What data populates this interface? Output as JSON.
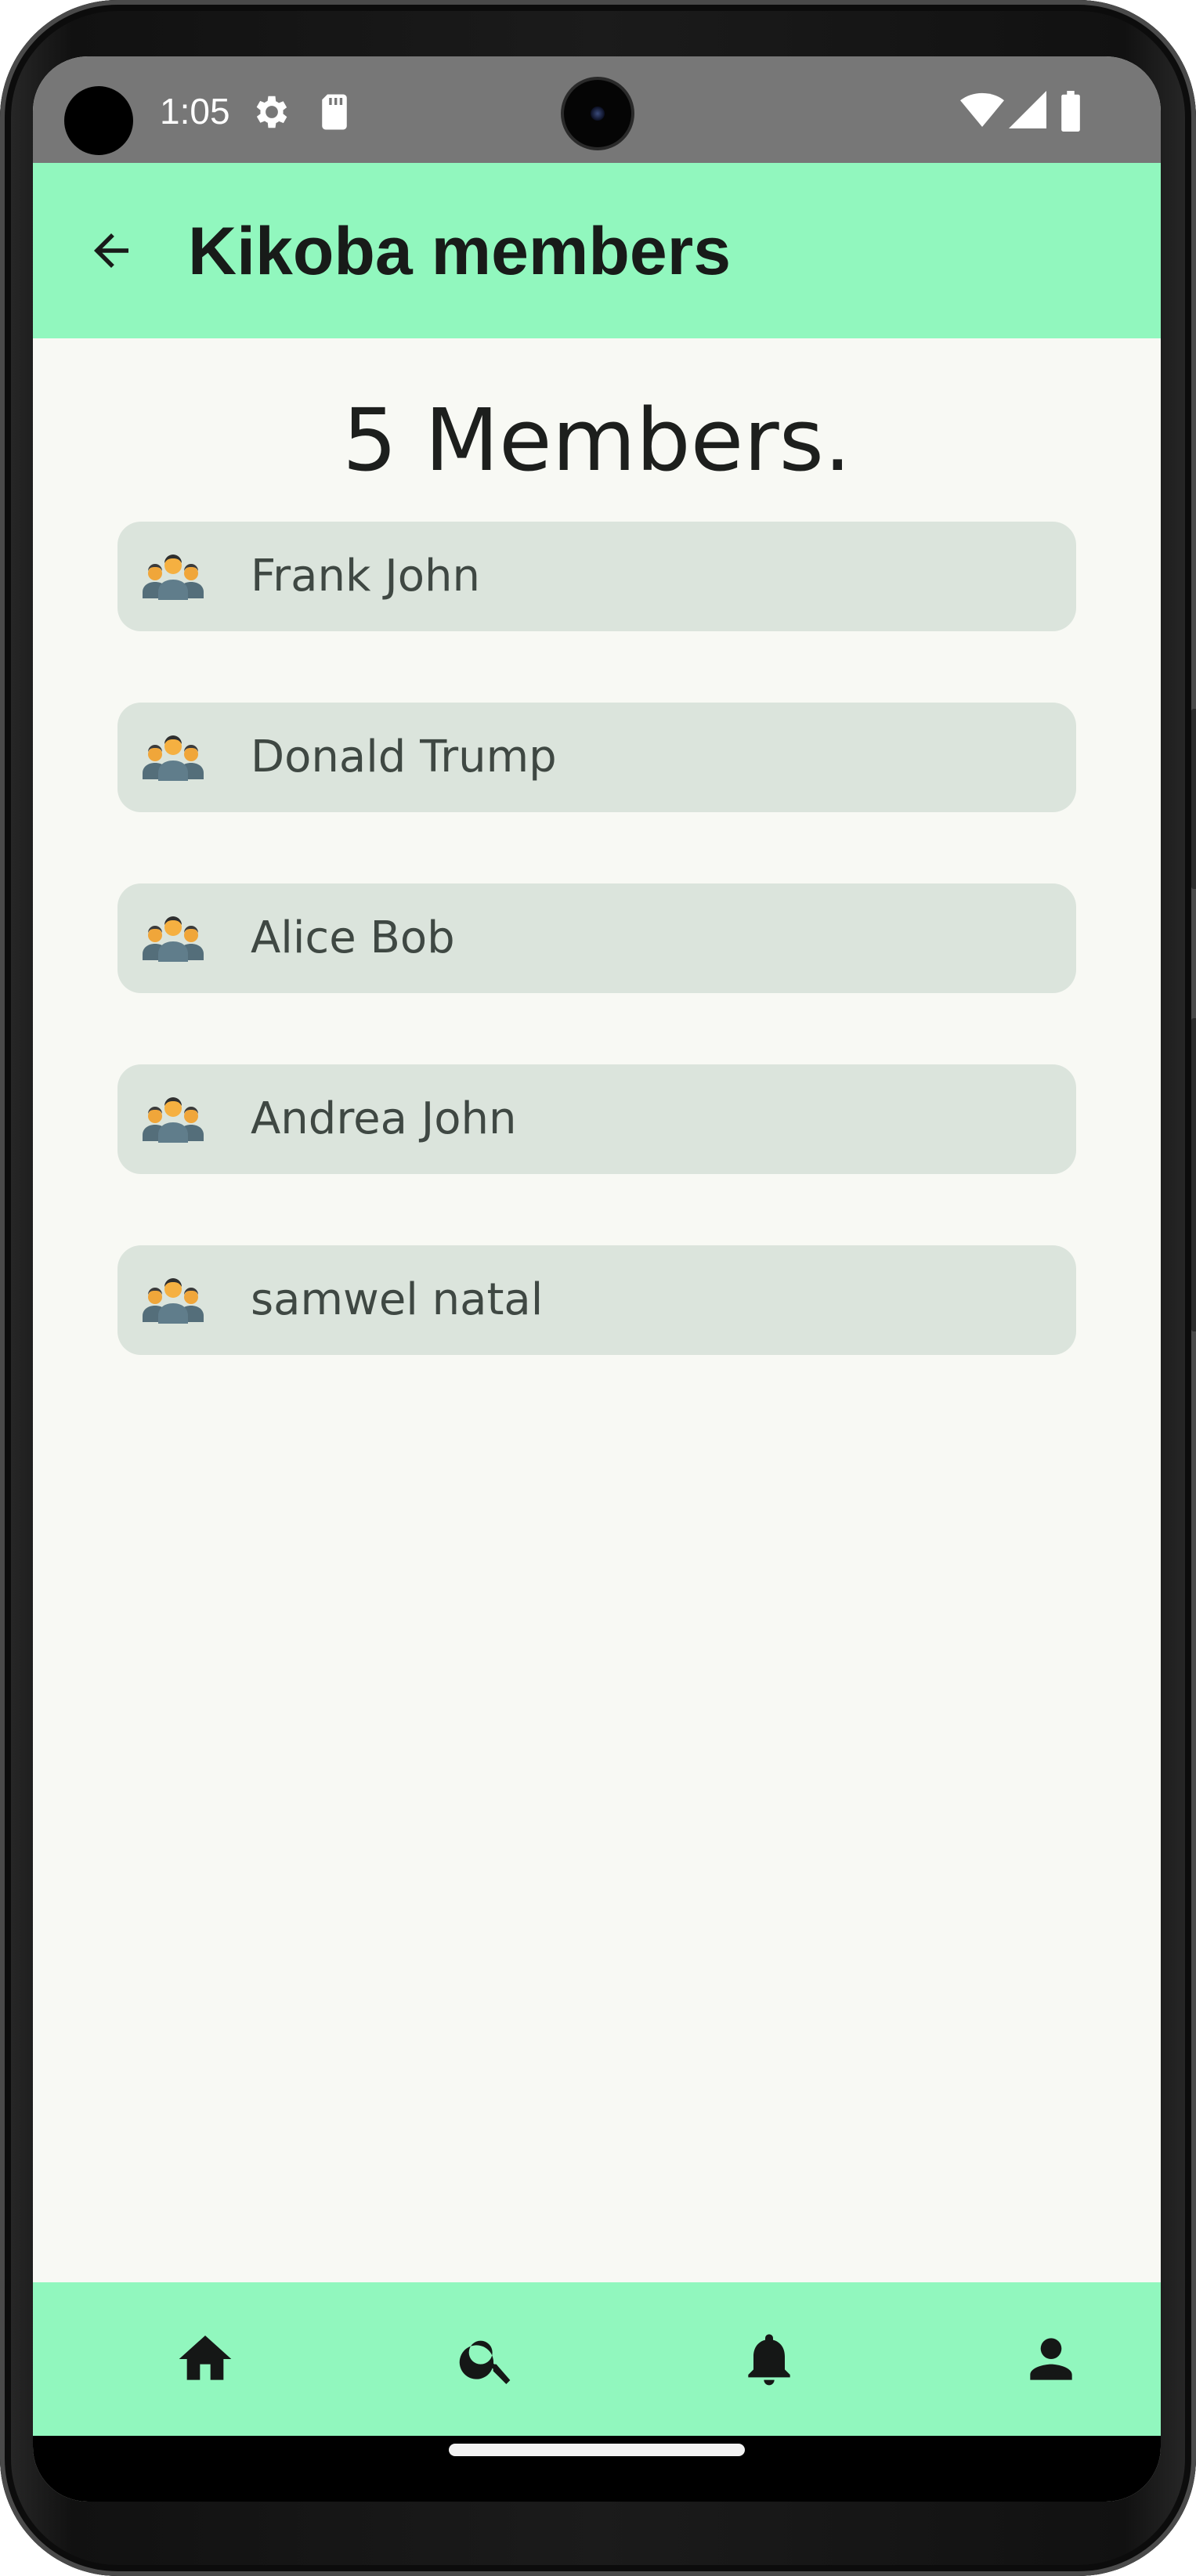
{
  "status_bar": {
    "time": "1:05",
    "icons": [
      "settings-gear-icon",
      "sd-card-icon",
      "wifi-icon",
      "cell-signal-icon",
      "battery-icon"
    ]
  },
  "app_bar": {
    "title": "Kikoba members",
    "back_icon": "arrow-left-icon"
  },
  "content": {
    "count_heading": "5 Members.",
    "members": [
      {
        "name": "Frank John",
        "icon": "group-people-icon"
      },
      {
        "name": "Donald Trump",
        "icon": "group-people-icon"
      },
      {
        "name": "Alice Bob",
        "icon": "group-people-icon"
      },
      {
        "name": "Andrea John",
        "icon": "group-people-icon"
      },
      {
        "name": "samwel natal",
        "icon": "group-people-icon"
      }
    ]
  },
  "bottom_nav": {
    "items": [
      {
        "icon": "home-icon"
      },
      {
        "icon": "search-icon"
      },
      {
        "icon": "bell-icon"
      },
      {
        "icon": "person-icon"
      }
    ]
  },
  "colors": {
    "app_bar": "#91f7be",
    "background": "#f8f9f4",
    "card": "#dbe4dc",
    "status_bar": "#777777"
  }
}
